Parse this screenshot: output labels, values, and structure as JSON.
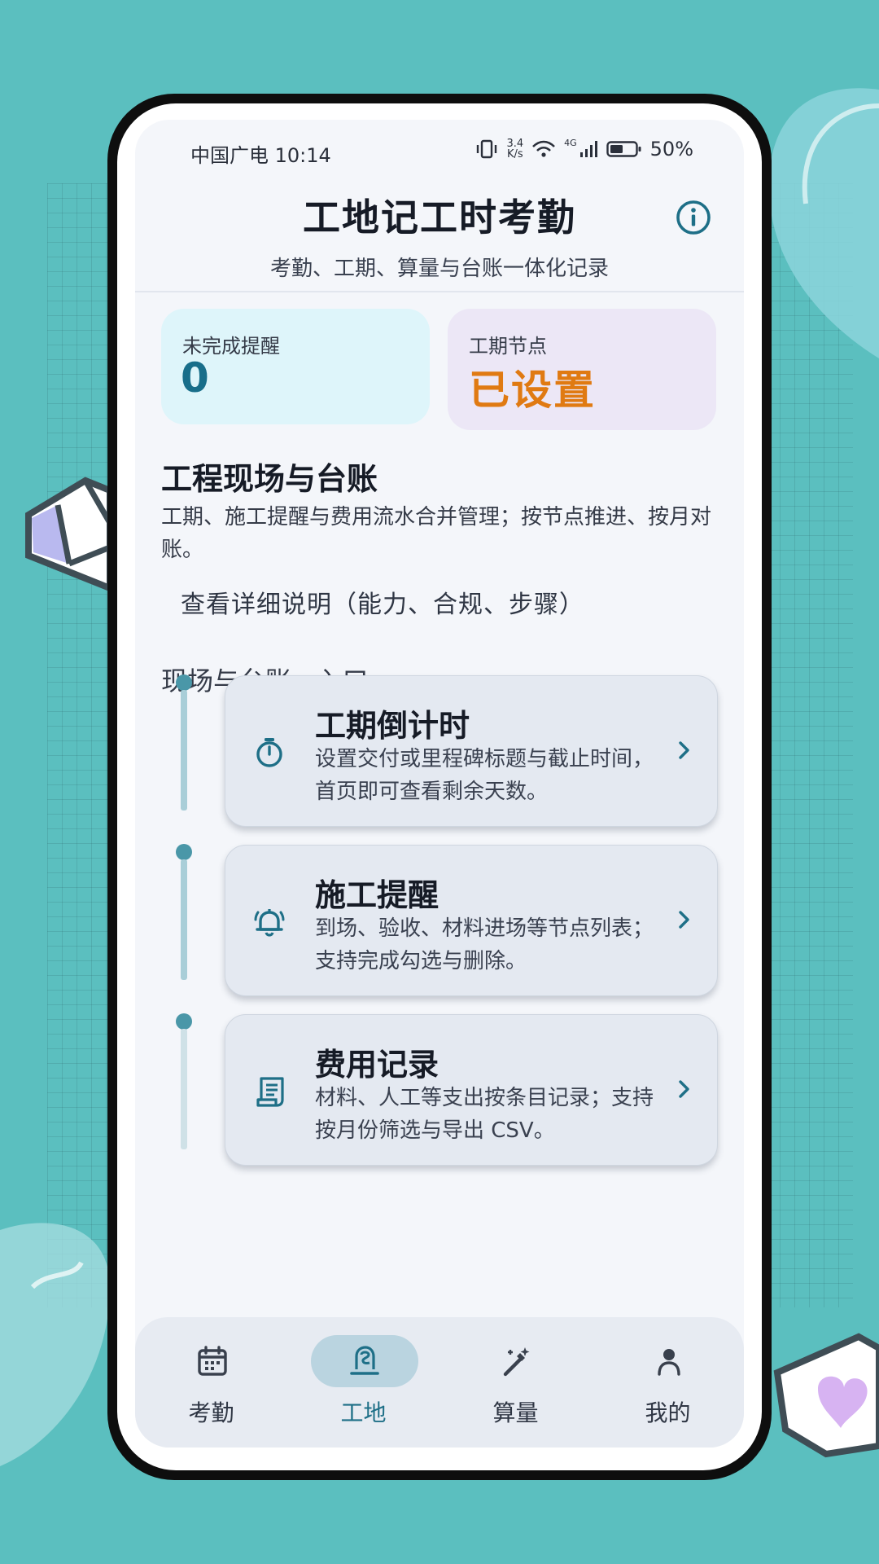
{
  "status_bar": {
    "carrier_time": "中国广电 10:14",
    "net_speed_value": "3.4",
    "net_speed_unit": "K/s",
    "network": "4G",
    "battery": "50%"
  },
  "header": {
    "title": "工地记工时考勤",
    "subtitle": "考勤、工期、算量与台账一体化记录",
    "info_icon": "info-icon"
  },
  "stats": [
    {
      "label": "未完成提醒",
      "value": "0",
      "color": "#186e8a",
      "bg": "#def5fa"
    },
    {
      "label": "工期节点",
      "value": "已设置",
      "color": "#e07a12",
      "bg": "#ece7f6"
    }
  ],
  "section": {
    "title": "工程现场与台账",
    "description": "工期、施工提醒与费用流水合并管理；按节点推进、按月对账。",
    "details_link": "查看详细说明（能力、合规、步骤）",
    "entry_heading": "现场与台账 · 入口"
  },
  "entries": [
    {
      "icon": "timer-icon",
      "title": "工期倒计时",
      "description": "设置交付或里程碑标题与截止时间，首页即可查看剩余天数。"
    },
    {
      "icon": "bell-icon",
      "title": "施工提醒",
      "description": "到场、验收、材料进场等节点列表；支持完成勾选与删除。"
    },
    {
      "icon": "receipt-icon",
      "title": "费用记录",
      "description": "材料、人工等支出按条目记录；支持按月份筛选与导出 CSV。"
    }
  ],
  "bottom_nav": [
    {
      "label": "考勤",
      "icon": "calendar-icon",
      "active": false
    },
    {
      "label": "工地",
      "icon": "helmet-icon",
      "active": true
    },
    {
      "label": "算量",
      "icon": "magic-pen-icon",
      "active": false
    },
    {
      "label": "我的",
      "icon": "person-icon",
      "active": false
    }
  ],
  "colors": {
    "accent": "#1e6f87",
    "background": "#5bbfbf",
    "timeline": "#4a97a8"
  }
}
